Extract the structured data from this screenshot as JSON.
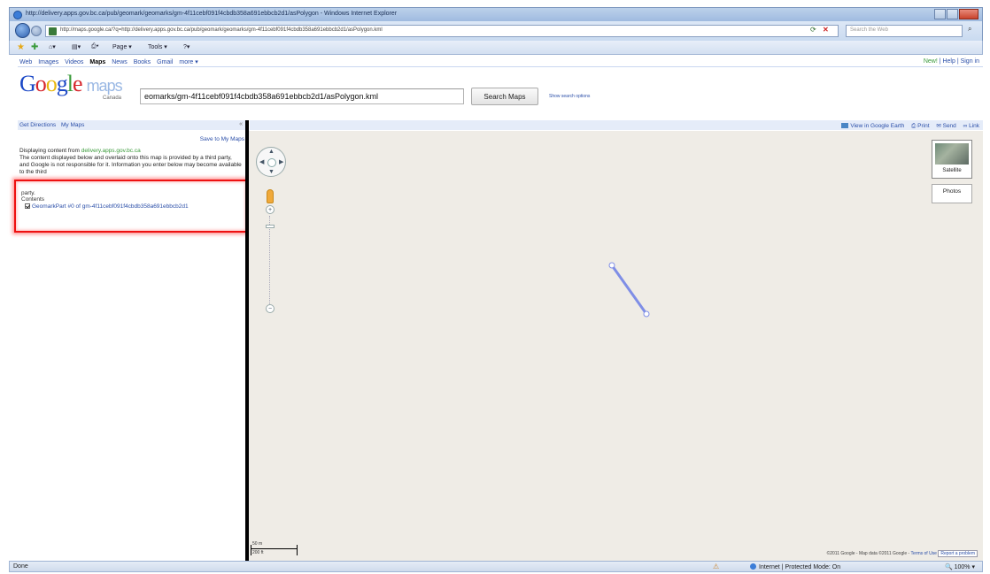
{
  "browser": {
    "title": "http://delivery.apps.gov.bc.ca/pub/geomark/geomarks/gm-4f11cebf091f4cbdb358a691ebbcb2d1/asPolygon - Windows Internet Explorer",
    "url": "http://maps.google.ca/?q=http://delivery.apps.gov.bc.ca/pub/geomark/geomarks/gm-4f11cebf091f4cbdb358a691ebbcb2d1/asPolygon.kml",
    "search_placeholder": "Search the Web",
    "commands": [
      "Page ▾",
      "Tools ▾"
    ],
    "status": "Done",
    "security_zone": "Internet | Protected Mode: On",
    "zoom_level": "100%"
  },
  "google_bar": {
    "links": [
      "Web",
      "Images",
      "Videos",
      "Maps",
      "News",
      "Books",
      "Gmail",
      "more ▾"
    ],
    "active": "Maps",
    "right_new": "New!",
    "right_links": "| Help | Sign in"
  },
  "header": {
    "logo_text": "Google",
    "logo_maps": "maps",
    "logo_region": "Canada",
    "search_value": "eomarks/gm-4f11cebf091f4cbdb358a691ebbcb2d1/asPolygon.kml",
    "search_button": "Search Maps",
    "search_options": "Show search options"
  },
  "panel": {
    "get_directions": "Get Directions",
    "my_maps": "My Maps",
    "save_link": "Save to My Maps",
    "display_prefix": "Displaying content from",
    "display_domain": "delivery.apps.gov.bc.ca",
    "display_body": "The content displayed below and overlaid onto this map is provided by a third party, and Google is not responsible for it. Information you enter below may become available to the third",
    "party": "party.",
    "contents": "Contents",
    "placemark": "GeomarkPart #0 of gm-4f11cebf091f4cbdb358a691ebbcb2d1"
  },
  "map_toolbar": {
    "view_earth": "View in Google Earth",
    "print": "Print",
    "send": "Send",
    "link": "Link"
  },
  "map": {
    "satellite_label": "Satellite",
    "photos_label": "Photos",
    "scale_top": "50 m",
    "scale_bottom": "200 ft",
    "attribution_text": "©2011 Google - Map data ©2011 Google -",
    "terms": "Terms of Use",
    "report": "Report a problem"
  }
}
